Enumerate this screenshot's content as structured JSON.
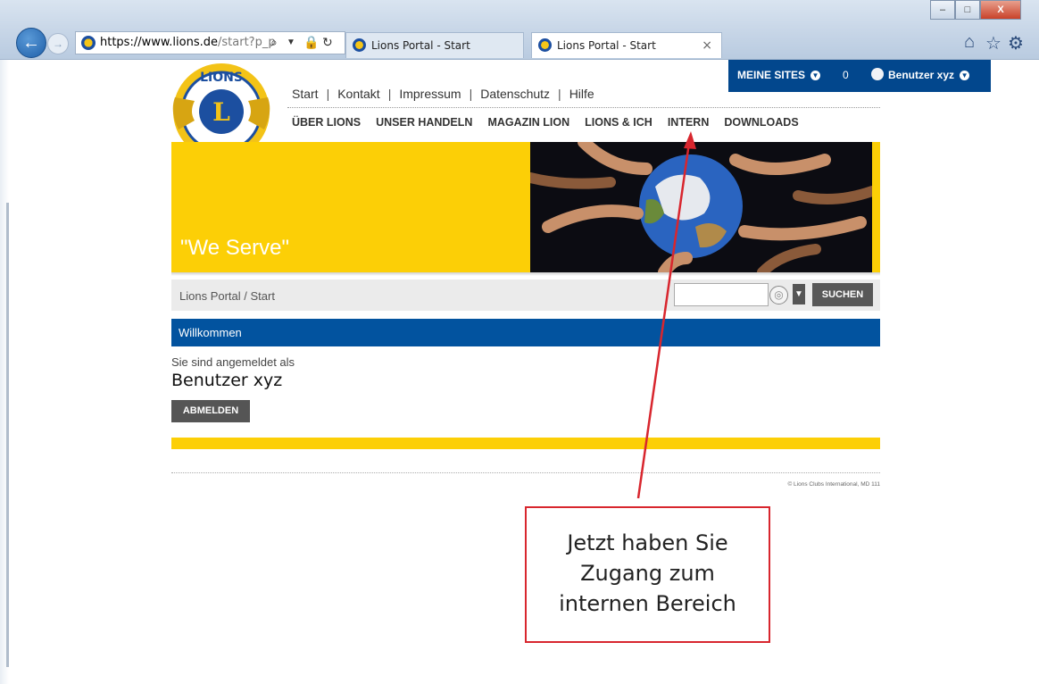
{
  "browser": {
    "url_host": "https://www.lions.de",
    "url_path": "/start?p_p",
    "tabs": [
      {
        "label": "Lions Portal - Start"
      },
      {
        "label": "Lions Portal - Start",
        "close": "×"
      }
    ],
    "window_buttons": {
      "minimize": "–",
      "maximize": "□",
      "close": "X"
    }
  },
  "header": {
    "utility_nav": [
      "Start",
      "Kontakt",
      "Impressum",
      "Datenschutz",
      "Hilfe"
    ],
    "separator": "|",
    "main_nav": [
      "ÜBER LIONS",
      "UNSER HANDELN",
      "MAGAZIN LION",
      "LIONS & ICH",
      "INTERN",
      "DOWNLOADS"
    ],
    "logo_text": "LIONS INTERNATIONAL"
  },
  "user_bar": {
    "sites_label": "MEINE SITES",
    "count": "0",
    "user_name": "Benutzer xyz"
  },
  "banner": {
    "slogan": "\"We Serve\""
  },
  "breadcrumb": {
    "text": "Lions Portal / Start",
    "search_button": "SUCHEN"
  },
  "welcome": {
    "title": "Willkommen",
    "logged_in_label": "Sie sind angemeldet als",
    "user_name": "Benutzer xyz",
    "logout_button": "ABMELDEN"
  },
  "footer": {
    "copyright": "© Lions Clubs International, MD 111"
  },
  "annotation": {
    "lines": [
      "Jetzt haben Sie",
      "Zugang zum",
      "internen Bereich"
    ],
    "color": "#d8262e"
  },
  "colors": {
    "lions_blue": "#02478d",
    "lions_yellow": "#fccf06",
    "welcome_blue": "#02539f"
  }
}
